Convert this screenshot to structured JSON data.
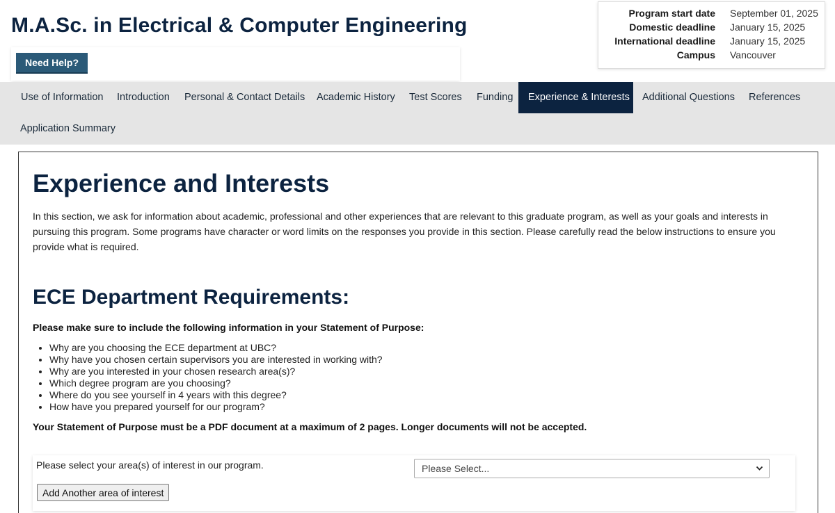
{
  "header": {
    "title": "M.A.Sc. in Electrical & Computer Engineering",
    "help_label": "Need Help?"
  },
  "program_info": [
    {
      "label": "Program start date",
      "value": "September 01, 2025"
    },
    {
      "label": "Domestic deadline",
      "value": "January 15, 2025"
    },
    {
      "label": "International deadline",
      "value": "January 15, 2025"
    },
    {
      "label": "Campus",
      "value": "Vancouver"
    }
  ],
  "nav": {
    "items": [
      "Use of Information",
      "Introduction",
      "Personal & Contact Details",
      "Academic History",
      "Test Scores",
      "Funding",
      "Experience & Interests",
      "Additional Questions",
      "References",
      "Application Summary"
    ],
    "active": "Experience & Interests"
  },
  "main": {
    "title": "Experience and Interests",
    "intro": "In this section, we ask for information about academic, professional and other experiences that are relevant to this graduate program, as well as your goals and interests in pursuing this program. Some programs have character or word limits on the responses you provide in this section. Please carefully read the below instructions to ensure you provide what is required.",
    "requirements_title": "ECE Department Requirements:",
    "requirements_note": "Please make sure to include the following information in your Statement of Purpose:",
    "requirements": [
      "Why are you choosing the ECE department at UBC?",
      "Why have you chosen certain supervisors you are interested in working with?",
      "Why are you interested in your chosen research area(s)?",
      "Which degree program are you choosing?",
      "Where do you see yourself in 4 years with this degree?",
      "How have you prepared yourself for our program?"
    ],
    "requirements_warning": "Your Statement of Purpose must be a PDF document at a maximum of 2 pages. Longer documents will not be accepted.",
    "area_label": "Please select your area(s) of interest in our program.",
    "area_select_value": "Please Select...",
    "add_area_label": "Add Another area of interest"
  },
  "colors": {
    "brand_navy": "#0c2340",
    "help_button": "#2b5a78",
    "nav_background": "#e5e5e5"
  }
}
